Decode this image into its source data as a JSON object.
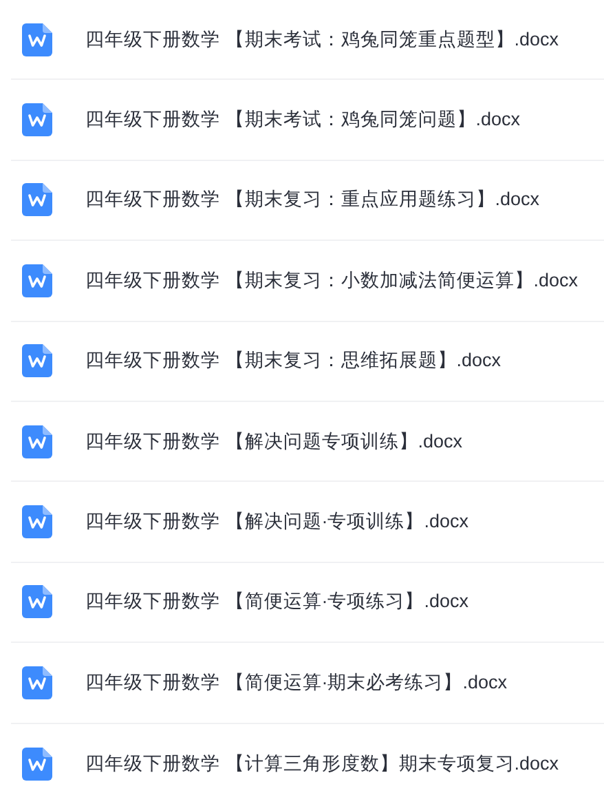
{
  "files": [
    {
      "name": "四年级下册数学 【期末考试：鸡兔同笼重点题型】.docx"
    },
    {
      "name": "四年级下册数学 【期末考试：鸡兔同笼问题】.docx"
    },
    {
      "name": "四年级下册数学 【期末复习：重点应用题练习】.docx"
    },
    {
      "name": "四年级下册数学 【期末复习：小数加减法简便运算】.docx"
    },
    {
      "name": "四年级下册数学 【期末复习：思维拓展题】.docx"
    },
    {
      "name": "四年级下册数学 【解决问题专项训练】.docx"
    },
    {
      "name": "四年级下册数学 【解决问题·专项训练】.docx"
    },
    {
      "name": "四年级下册数学 【简便运算·专项练习】.docx"
    },
    {
      "name": "四年级下册数学 【简便运算·期末必考练习】.docx"
    },
    {
      "name": "四年级下册数学 【计算三角形度数】期末专项复习.docx"
    }
  ]
}
